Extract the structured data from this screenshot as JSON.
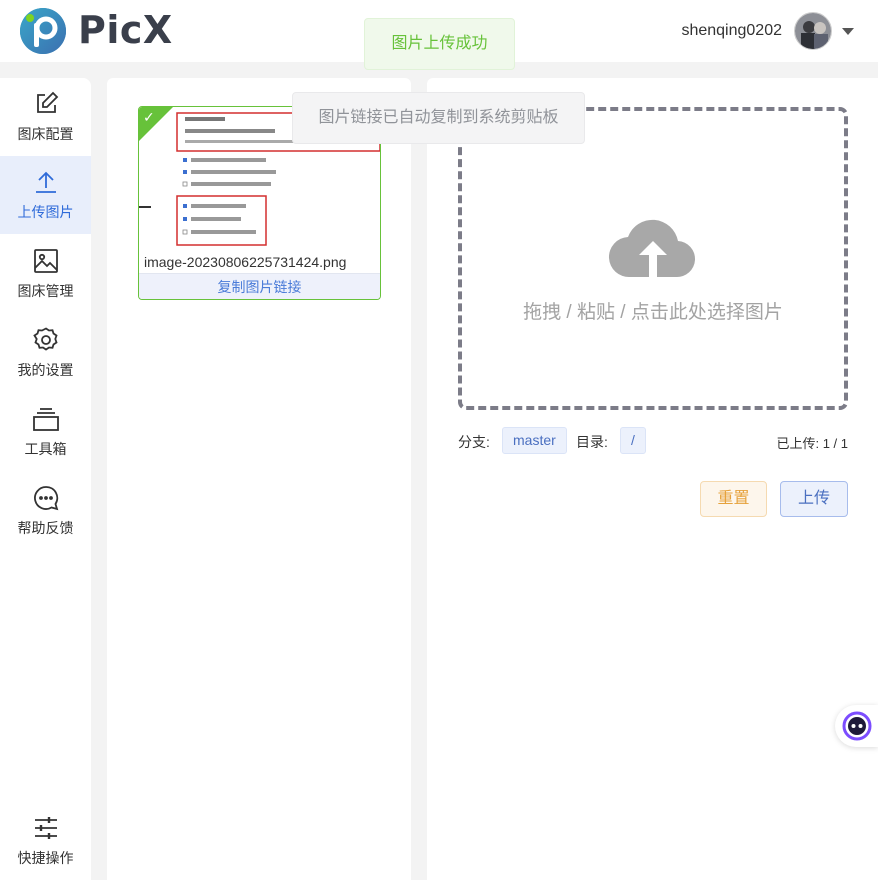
{
  "header": {
    "brand": "PicX",
    "username": "shenqing0202"
  },
  "sidebar": {
    "items": [
      {
        "label": "图床配置",
        "icon": "edit-icon"
      },
      {
        "label": "上传图片",
        "icon": "upload-icon",
        "active": true
      },
      {
        "label": "图床管理",
        "icon": "image-icon"
      },
      {
        "label": "我的设置",
        "icon": "gear-icon"
      },
      {
        "label": "工具箱",
        "icon": "toolbox-icon"
      },
      {
        "label": "帮助反馈",
        "icon": "chat-icon"
      },
      {
        "label": "快捷操作",
        "icon": "sliders-icon"
      }
    ]
  },
  "uploaded_card": {
    "filename": "image-20230806225731424.png",
    "copy_label": "复制图片链接"
  },
  "dropzone": {
    "text": "拖拽 / 粘贴 / 点击此处选择图片"
  },
  "meta": {
    "branch_label": "分支:",
    "branch_value": "master",
    "dir_label": "目录:",
    "dir_value": "/",
    "uploaded_label": "已上传: 1 / 1"
  },
  "buttons": {
    "reset": "重置",
    "upload": "上传"
  },
  "toasts": {
    "success": "图片上传成功",
    "info": "图片链接已自动复制到系统剪贴板"
  },
  "colors": {
    "accent": "#2f6bd9",
    "success": "#67c23a",
    "warning": "#e6a23c"
  }
}
